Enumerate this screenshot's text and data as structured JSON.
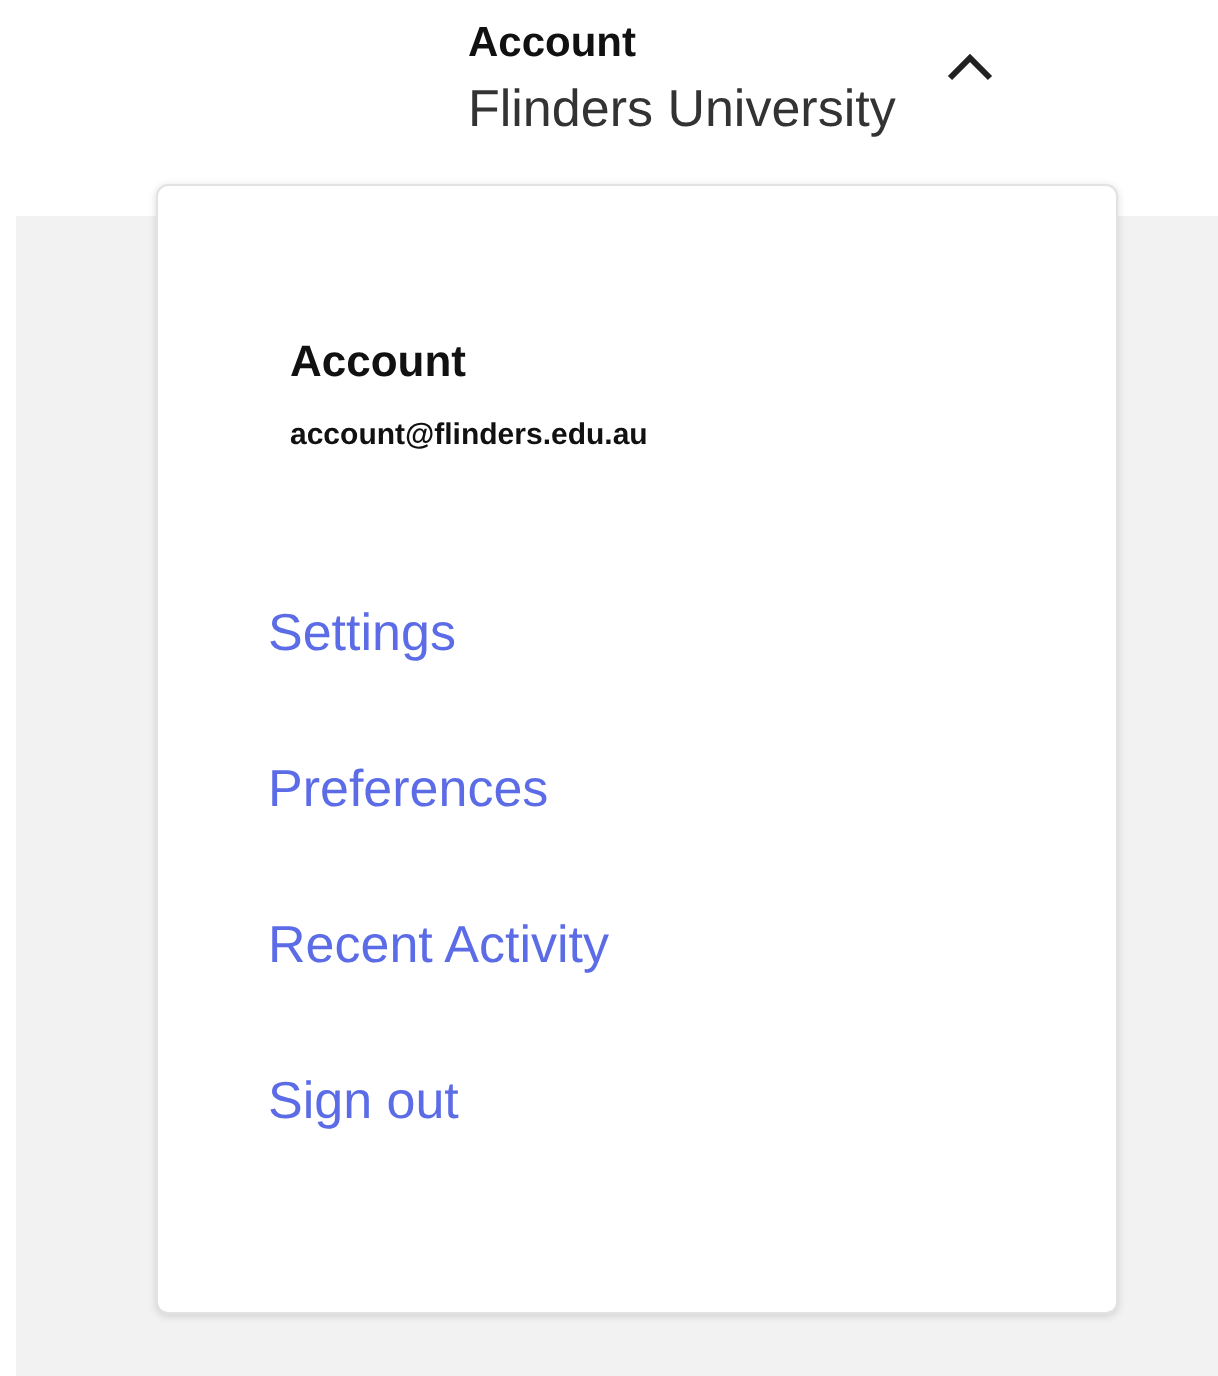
{
  "account_button": {
    "label": "Account",
    "organization": "Flinders University",
    "expanded": true
  },
  "menu": {
    "name": "Account",
    "email": "account@flinders.edu.au",
    "items": [
      "Settings",
      "Preferences",
      "Recent Activity",
      "Sign out"
    ]
  }
}
